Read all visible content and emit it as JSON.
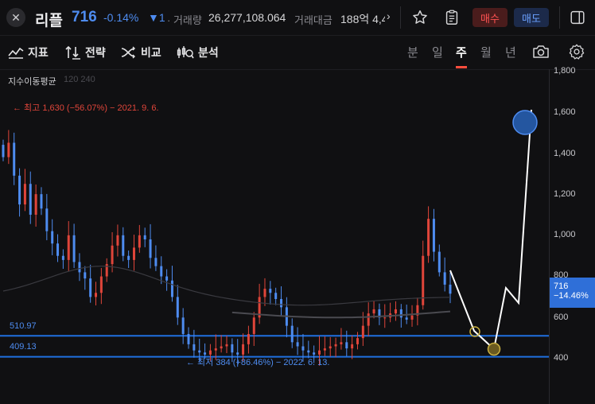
{
  "header": {
    "close_icon": "close-icon",
    "coin_name": "리플",
    "price": "716",
    "change_pct": "-0.14%",
    "change_arrow": "▼1",
    "volume_label": "· 거래량",
    "volume_value": "26,277,108.064",
    "amount_label": "거래대금",
    "amount_value": "188억 4,4",
    "more_icon": "chevron-right-icon",
    "favorite_icon": "star-icon",
    "order_icon": "clipboard-icon",
    "buy_label": "매수",
    "sell_label": "매도",
    "panel_icon": "panel-toggle-icon"
  },
  "toolbar": {
    "indicator_label": "지표",
    "strategy_label": "전략",
    "compare_label": "비교",
    "analysis_label": "분석",
    "timeframes": [
      "분",
      "일",
      "주",
      "월",
      "년"
    ],
    "active_timeframe": "주",
    "camera_icon": "camera-icon",
    "settings_icon": "gear-icon"
  },
  "chart": {
    "indicator_name": "지수이동평균",
    "indicator_params": "120 240",
    "high_note": "← 최고 1,630 (−56.07%) − 2021. 9. 6.",
    "low_note": "← 최저 384 (+86.46%) − 2022. 6. 13.",
    "levels": [
      "510.97",
      "409.13"
    ],
    "current_price_tag": "716",
    "current_change_tag": "−14.46%",
    "colors": {
      "up": "#e0453a",
      "down": "#4e8cf0",
      "level_line": "#1f6fe0",
      "drawing": "#ffffff"
    }
  },
  "chart_data": {
    "type": "candlestick",
    "yaxis_ticks": [
      "1,800",
      "1,600",
      "1,400",
      "1,200",
      "1,000",
      "800",
      "600",
      "400"
    ],
    "ylim": [
      300,
      1800
    ],
    "horizontal_levels": [
      510.97,
      409.13
    ],
    "high": 1630,
    "low": 384,
    "last": 716,
    "approx_closes": [
      1380,
      1450,
      1290,
      1150,
      1250,
      1100,
      1200,
      1130,
      1020,
      960,
      900,
      880,
      1000,
      870,
      820,
      790,
      700,
      720,
      800,
      860,
      950,
      1000,
      900,
      880,
      940,
      1000,
      980,
      890,
      850,
      800,
      780,
      700,
      600,
      520,
      470,
      440,
      430,
      420,
      440,
      450,
      460,
      470,
      430,
      420,
      470,
      520,
      600,
      700,
      740,
      720,
      690,
      650,
      560,
      480,
      460,
      440,
      430,
      420,
      440,
      450,
      460,
      470,
      480,
      450,
      470,
      500,
      560,
      620,
      640,
      600,
      600,
      620,
      640,
      600,
      590,
      610,
      660,
      900,
      1080,
      920,
      820,
      760,
      716
    ],
    "projection": [
      [
        716,
        680
      ],
      [
        540,
        620
      ],
      [
        460,
        440
      ],
      [
        760,
        490
      ],
      [
        820,
        430
      ],
      [
        1600,
        1520
      ]
    ]
  }
}
